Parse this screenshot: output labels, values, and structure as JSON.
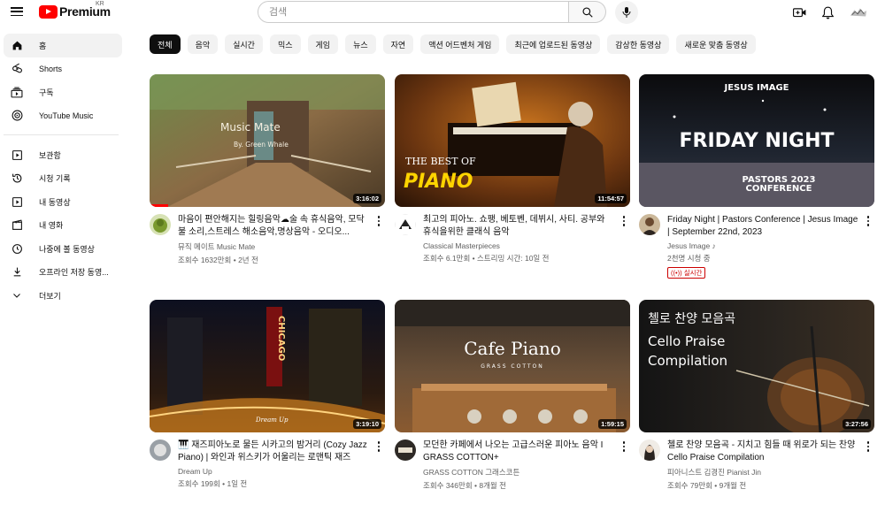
{
  "header": {
    "logo_text": "Premium",
    "region": "KR",
    "search_placeholder": "검색"
  },
  "sidebar": {
    "primary": [
      {
        "label": "홈",
        "icon": "home-icon"
      },
      {
        "label": "Shorts",
        "icon": "shorts-icon"
      },
      {
        "label": "구독",
        "icon": "subscriptions-icon"
      },
      {
        "label": "YouTube Music",
        "icon": "youtube-music-icon"
      }
    ],
    "secondary": [
      {
        "label": "보관함",
        "icon": "library-icon"
      },
      {
        "label": "시청 기록",
        "icon": "history-icon"
      },
      {
        "label": "내 동영상",
        "icon": "my-videos-icon"
      },
      {
        "label": "내 영화",
        "icon": "my-movies-icon"
      },
      {
        "label": "나중에 볼 동영상",
        "icon": "watch-later-icon"
      },
      {
        "label": "오프라인 저장 동영...",
        "icon": "download-icon"
      },
      {
        "label": "더보기",
        "icon": "chevron-down-icon"
      }
    ]
  },
  "chips": [
    "전체",
    "음악",
    "실시간",
    "믹스",
    "게임",
    "뉴스",
    "자연",
    "액션 어드벤처 게임",
    "최근에 업로드된 동영상",
    "감상한 동영상",
    "새로운 맞춤 동영상"
  ],
  "videos": [
    {
      "title": "마음이 편안해지는 힐링음악☁술 속 휴식음악, 모닥불 소리,스트레스 해소음악,명상음악 - 오디오...",
      "channel": "뮤직 메이트 Music Mate",
      "stats": "조회수 1632만회 • 2년 전",
      "duration": "3:16:02",
      "thumb_text": [
        "Music Mate",
        "By. Green Whale"
      ],
      "progress": 0.08
    },
    {
      "title": "최고의 피아노. 쇼팽, 베토벤, 데뷔시, 사티. 공부와 휴식을위한 클래식 음악",
      "channel": "Classical Masterpieces",
      "stats": "조회수 6.1만회 • 스트리밍 시간: 10일 전",
      "duration": "11:54:57",
      "thumb_text": [
        "THE BEST OF",
        "PIANO"
      ]
    },
    {
      "title": "Friday Night | Pastors Conference | Jesus Image | September 22nd, 2023",
      "channel": "Jesus Image ♪",
      "stats": "2천명 시청 중",
      "live_badge": "((•)) 실시간",
      "thumb_text": [
        "JESUS IMAGE",
        "FRIDAY NIGHT",
        "PASTORS 2023",
        "CONFERENCE"
      ]
    },
    {
      "title": "🎹 재즈피아노로 물든 시카고의 밤거리 (Cozy Jazz Piano) | 와인과 위스키가 어울리는 로맨틱 재즈",
      "channel": "Dream Up",
      "stats": "조회수 199회 • 1일 전",
      "duration": "3:19:10",
      "thumb_text": [
        "CHICAGO",
        "Dream Up"
      ]
    },
    {
      "title": "모던한 카페에서 나오는 고급스러운 피아노 음악 I GRASS COTTON+",
      "channel": "GRASS COTTON 그래스코튼",
      "stats": "조회수 346만회 • 8개월 전",
      "duration": "1:59:15",
      "thumb_text": [
        "Cafe Piano",
        "GRASS COTTON"
      ]
    },
    {
      "title": "첼로 찬양 모음곡 - 지치고 힘들 때 위로가 되는 찬양 Cello Praise Compilation",
      "channel": "피아니스트 김경진 Pianist Jin",
      "stats": "조회수 79만회 • 9개월 전",
      "duration": "3:27:56",
      "thumb_text": [
        "첼로 찬양 모음곡",
        "Cello Praise",
        "Compilation"
      ]
    }
  ],
  "colors": {
    "brand_red": "#ff0000",
    "chip_active": "#0f0f0f",
    "chip_bg": "#f2f2f2",
    "live_red": "#cc0000"
  }
}
